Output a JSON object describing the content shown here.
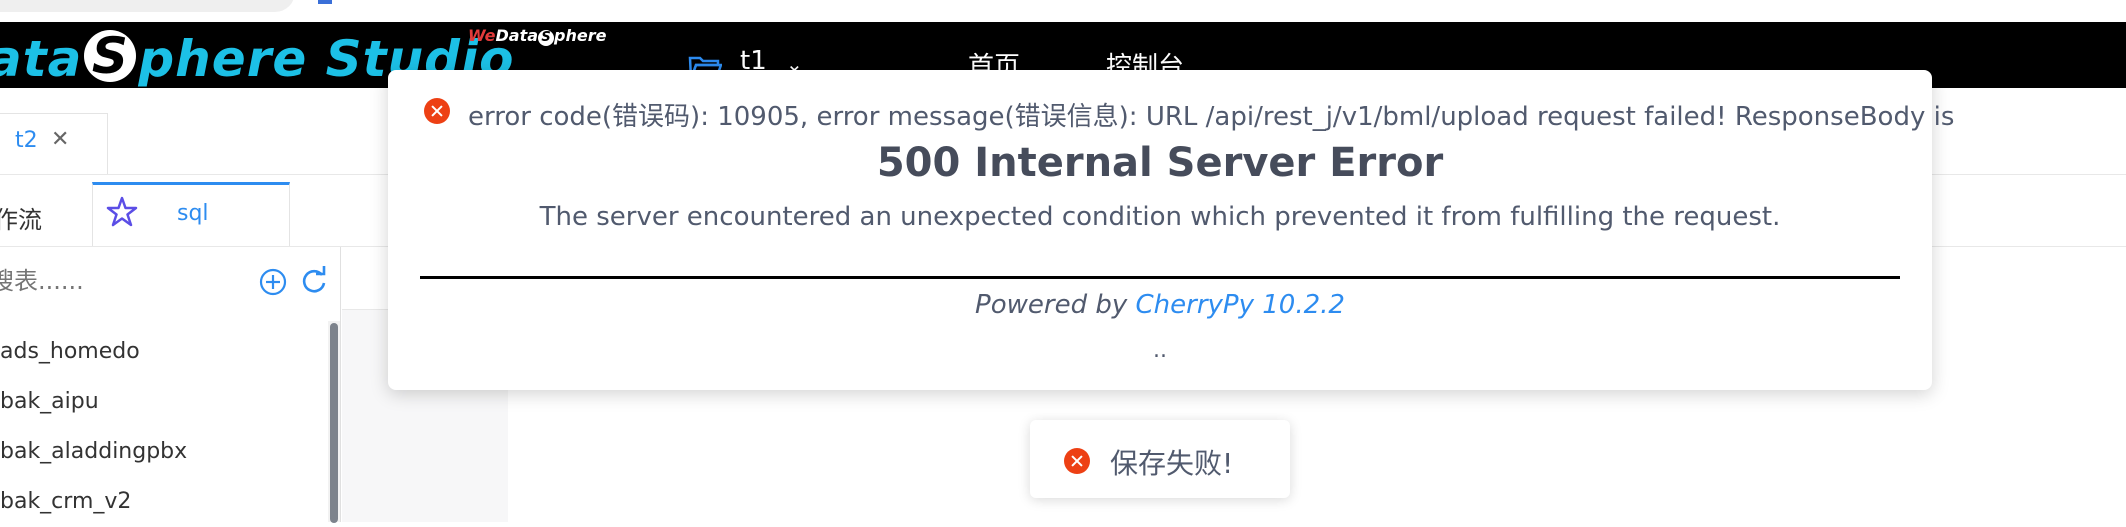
{
  "header": {
    "logo_prefix": "ata",
    "logo_s": "S",
    "logo_suffix": "phere Studio",
    "we_prefix": "We",
    "we_mid": "Data",
    "we_s": "S",
    "we_suffix": "phere",
    "workspace_name": "t1",
    "nav_home": "首页",
    "nav_console": "控制台"
  },
  "project_tab": {
    "label": "t2",
    "close_glyph": "✕"
  },
  "sub_tabs": {
    "workflow": "作流",
    "sql": "sql"
  },
  "sidebar": {
    "search_placeholder": "搜表......",
    "databases": [
      "ads_homedo",
      "bak_aipu",
      "bak_aladdingpbx",
      "bak_crm_v2"
    ]
  },
  "error_modal": {
    "code_line": "error code(错误码): 10905, error message(错误信息): URL /api/rest_j/v1/bml/upload request failed! ResponseBody is",
    "title": "500 Internal Server Error",
    "description": "The server encountered an unexpected condition which prevented it from fulfilling the request.",
    "powered_by": "Powered by",
    "powered_link": "CherryPy 10.2.2",
    "trailing": ".."
  },
  "toast": {
    "message": "保存失败!"
  },
  "colors": {
    "header_bg": "#000000",
    "logo": "#1cc0e6",
    "accent": "#2d8cf0",
    "error": "#ed4014"
  }
}
